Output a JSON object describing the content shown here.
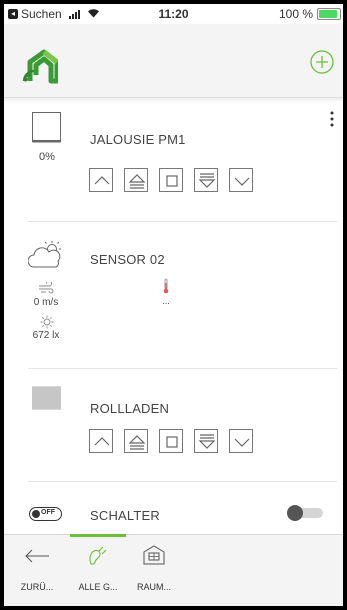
{
  "status_bar": {
    "carrier": "Suchen",
    "time": "11:20",
    "battery_text": "100 %",
    "battery_level": 1.0
  },
  "header": {
    "logo": "smart-home-wifi-logo",
    "add_icon": "plus-circle-icon",
    "accent_color": "#6cbf38"
  },
  "devices": [
    {
      "title": "JALOUSIE PM1",
      "position_text": "0%",
      "icon": "blind-icon",
      "controls": [
        "up",
        "step-up",
        "stop",
        "step-down",
        "down"
      ]
    },
    {
      "title": "SENSOR 02",
      "icon": "weather-cloud-sun-icon",
      "wind_value": "0 m/s",
      "temperature_value": "...",
      "light_value": "672 lx"
    },
    {
      "title": "ROLLLADEN",
      "icon": "roller-shutter-icon",
      "controls": [
        "up",
        "step-up",
        "stop",
        "step-down",
        "down"
      ]
    },
    {
      "title": "SCHALTER",
      "icon": "switch-off-icon",
      "switch_label": "OFF",
      "switch_on": false
    }
  ],
  "tabs": [
    {
      "label": "ZURÜ...",
      "icon": "arrow-left-icon",
      "active": false
    },
    {
      "label": "ALLE G...",
      "icon": "plug-icon",
      "active": true
    },
    {
      "label": "RAUM...",
      "icon": "room-icon",
      "active": false
    }
  ]
}
